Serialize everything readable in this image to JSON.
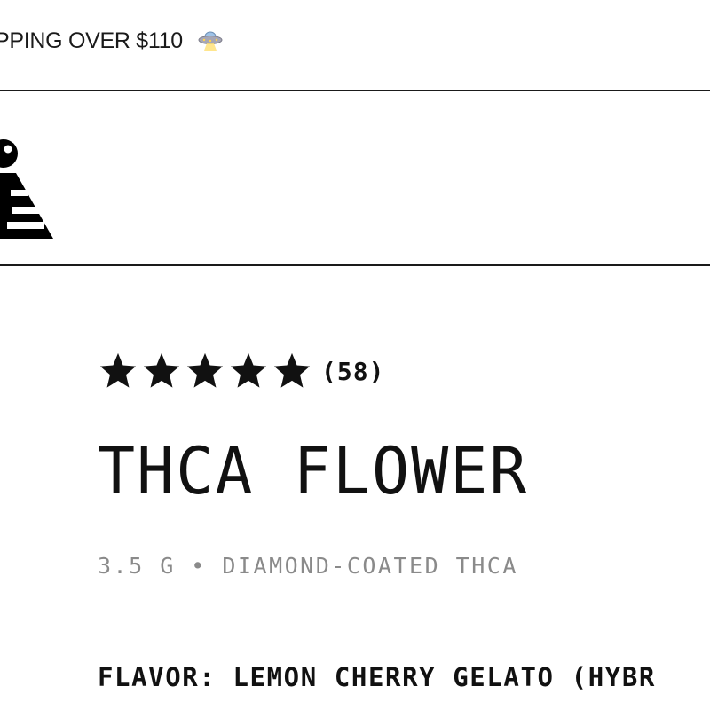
{
  "announcement": {
    "text": "PPING OVER $110",
    "icon": "ufo-icon"
  },
  "header": {
    "logo": "brand-logo"
  },
  "product": {
    "rating": {
      "stars": 5,
      "max_stars": 5,
      "review_count": "(58)"
    },
    "title": "THCA FLOWER",
    "subtitle": "3.5 G • DIAMOND-COATED THCA",
    "flavor": "FLAVOR: LEMON CHERRY GELATO (HYBR"
  },
  "colors": {
    "text": "#111111",
    "muted": "#8a8a8a",
    "background": "#ffffff",
    "rule": "#1a1a1a"
  }
}
